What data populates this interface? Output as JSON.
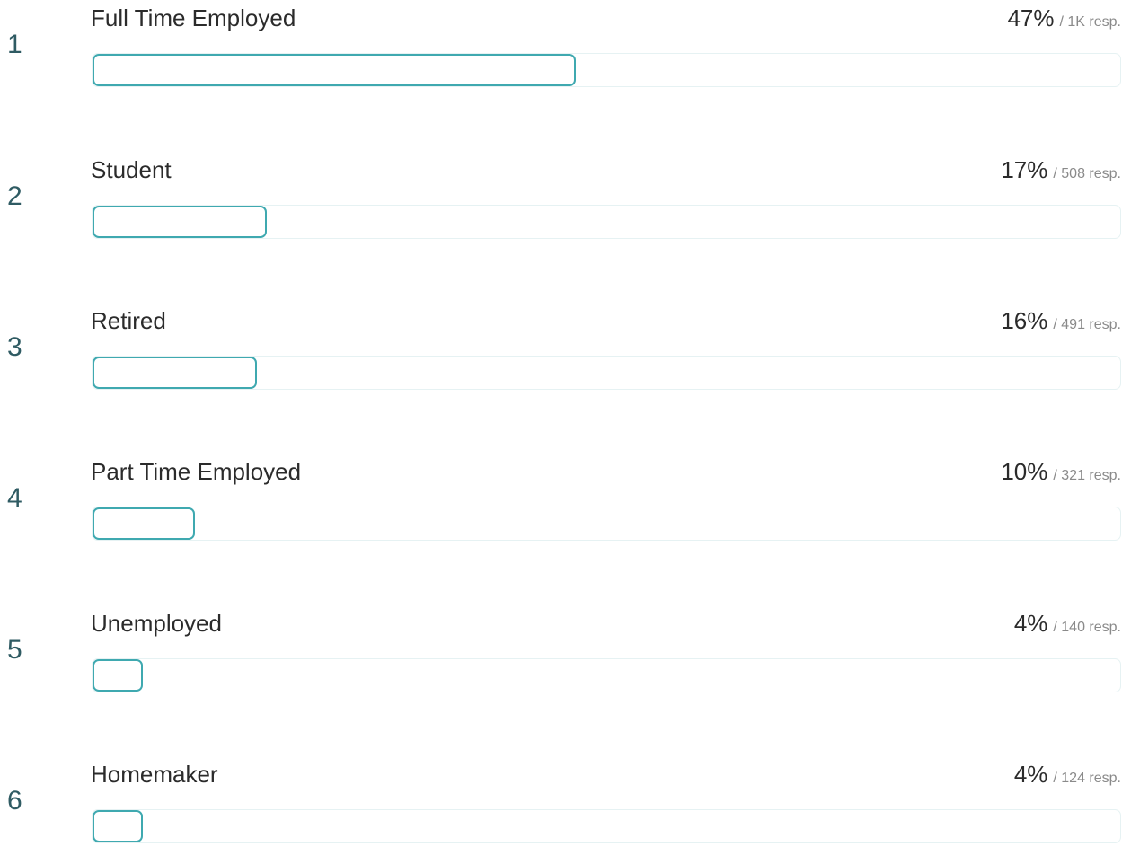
{
  "accent_color": "#3fa9b0",
  "results": [
    {
      "rank": "1",
      "label": "Full Time Employed",
      "percent_text": "47%",
      "responses_text": "1K resp.",
      "share": 0.47
    },
    {
      "rank": "2",
      "label": "Student",
      "percent_text": "17%",
      "responses_text": "508 resp.",
      "share": 0.17
    },
    {
      "rank": "3",
      "label": "Retired",
      "percent_text": "16%",
      "responses_text": "491 resp.",
      "share": 0.16
    },
    {
      "rank": "4",
      "label": "Part Time Employed",
      "percent_text": "10%",
      "responses_text": "321 resp.",
      "share": 0.1
    },
    {
      "rank": "5",
      "label": "Unemployed",
      "percent_text": "4%",
      "responses_text": "140 resp.",
      "share": 0.04
    },
    {
      "rank": "6",
      "label": "Homemaker",
      "percent_text": "4%",
      "responses_text": "124 resp.",
      "share": 0.04
    }
  ]
}
